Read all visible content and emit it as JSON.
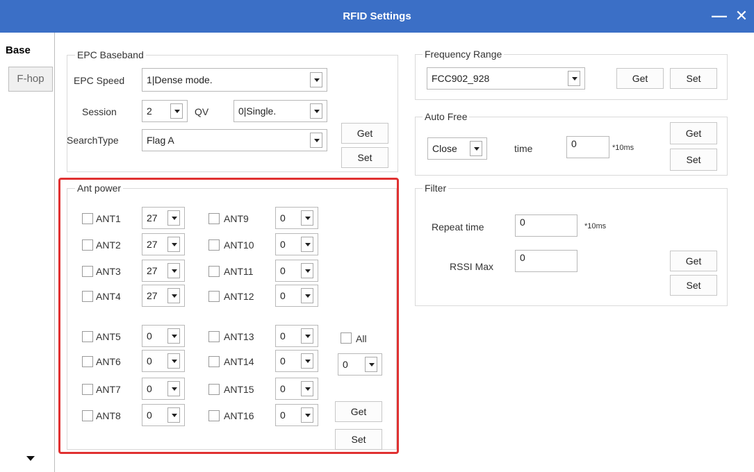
{
  "window": {
    "title": "RFID Settings",
    "minimize": "—",
    "close": "✕"
  },
  "tabs": [
    {
      "label": "Base",
      "active": true
    },
    {
      "label": "F-hop",
      "active": false
    }
  ],
  "epc_baseband": {
    "title": "EPC Baseband",
    "epc_speed_label": "EPC Speed",
    "epc_speed_value": "1|Dense mode.",
    "session_label": "Session",
    "session_value": "2",
    "qv_label": "QV",
    "qv_value": "0|Single.",
    "search_type_label": "SearchType",
    "search_type_value": "Flag A",
    "get_label": "Get",
    "set_label": "Set"
  },
  "ant_power": {
    "title": "Ant power",
    "ants": [
      {
        "label": "ANT1",
        "value": "27"
      },
      {
        "label": "ANT2",
        "value": "27"
      },
      {
        "label": "ANT3",
        "value": "27"
      },
      {
        "label": "ANT4",
        "value": "27"
      },
      {
        "label": "ANT5",
        "value": "0"
      },
      {
        "label": "ANT6",
        "value": "0"
      },
      {
        "label": "ANT7",
        "value": "0"
      },
      {
        "label": "ANT8",
        "value": "0"
      },
      {
        "label": "ANT9",
        "value": "0"
      },
      {
        "label": "ANT10",
        "value": "0"
      },
      {
        "label": "ANT11",
        "value": "0"
      },
      {
        "label": "ANT12",
        "value": "0"
      },
      {
        "label": "ANT13",
        "value": "0"
      },
      {
        "label": "ANT14",
        "value": "0"
      },
      {
        "label": "ANT15",
        "value": "0"
      },
      {
        "label": "ANT16",
        "value": "0"
      }
    ],
    "all_label": "All",
    "all_value": "0",
    "get_label": "Get",
    "set_label": "Set"
  },
  "frequency_range": {
    "title": "Frequency Range",
    "value": "FCC902_928",
    "get_label": "Get",
    "set_label": "Set"
  },
  "auto_free": {
    "title": "Auto Free",
    "mode_value": "Close",
    "time_label": "time",
    "time_value": "0",
    "unit": "*10ms",
    "get_label": "Get",
    "set_label": "Set"
  },
  "filter": {
    "title": "Filter",
    "repeat_label": "Repeat time",
    "repeat_value": "0",
    "repeat_unit": "*10ms",
    "rssi_label": "RSSI Max",
    "rssi_value": "0",
    "get_label": "Get",
    "set_label": "Set"
  },
  "colors": {
    "titlebar": "#3b6fc6",
    "highlight": "#e03131"
  }
}
